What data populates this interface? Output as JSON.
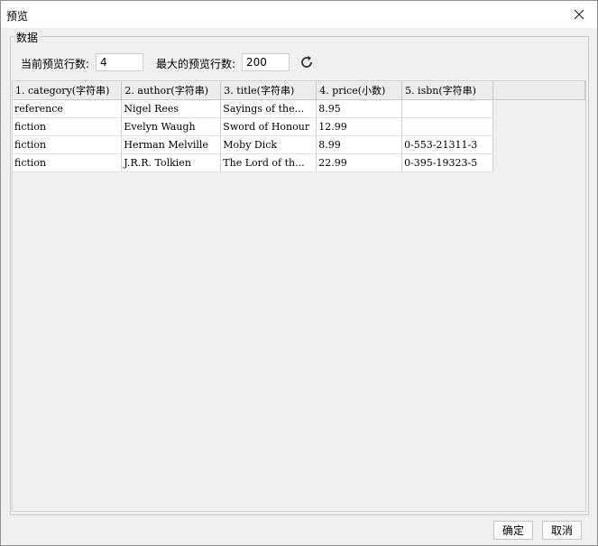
{
  "window": {
    "title": "预览"
  },
  "group": {
    "label": "数据"
  },
  "controls": {
    "current_rows_label": "当前预览行数:",
    "current_rows_value": "4",
    "max_rows_label": "最大的预览行数:",
    "max_rows_value": "200"
  },
  "table": {
    "columns": [
      "1. category(字符串)",
      "2. author(字符串)",
      "3. title(字符串)",
      "4. price(小数)",
      "5. isbn(字符串)"
    ],
    "rows": [
      [
        "reference",
        "Nigel Rees",
        "Sayings of the...",
        "8.95",
        ""
      ],
      [
        "fiction",
        "Evelyn Waugh",
        "Sword of Honour",
        "12.99",
        ""
      ],
      [
        "fiction",
        "Herman Melville",
        "Moby Dick",
        "8.99",
        "0-553-21311-3"
      ],
      [
        "fiction",
        "J.R.R. Tolkien",
        "The Lord of th...",
        "22.99",
        "0-395-19323-5"
      ]
    ]
  },
  "buttons": {
    "ok": "确定",
    "cancel": "取消"
  }
}
